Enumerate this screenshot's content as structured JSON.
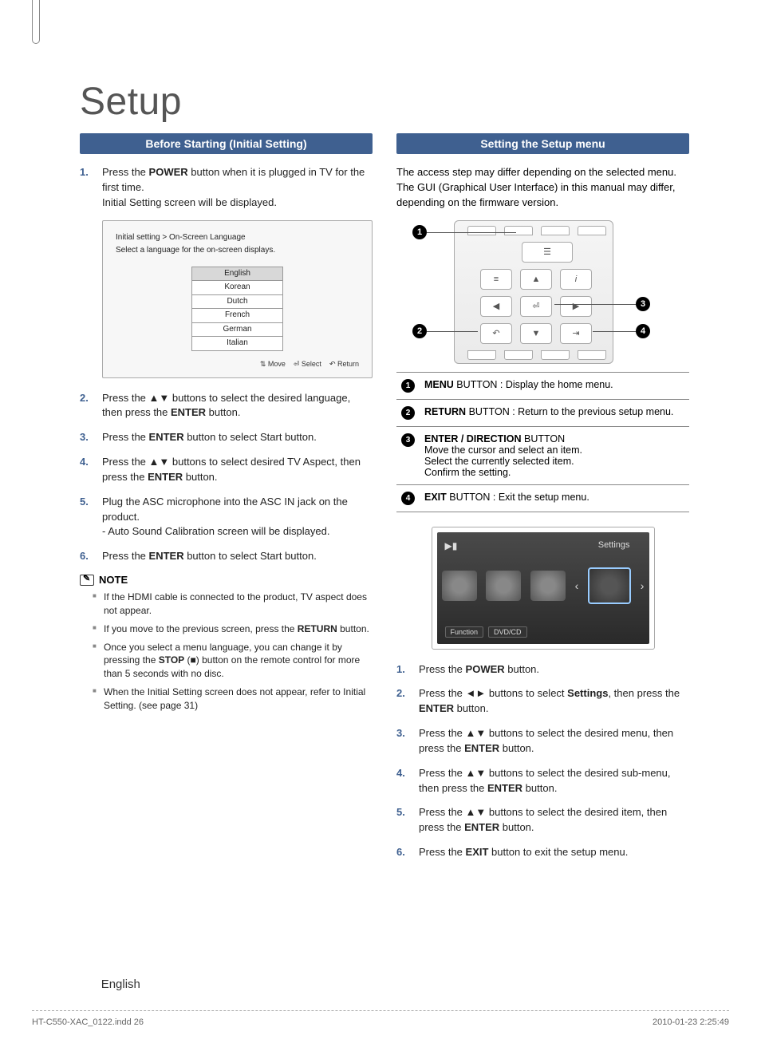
{
  "title": "Setup",
  "left": {
    "header": "Before Starting (Initial Setting)",
    "steps": [
      {
        "text": "Press the <b>POWER</b> button when it is plugged in TV for the first time.",
        "sub": "Initial Setting screen will be displayed."
      },
      {
        "text": "Press the ▲▼ buttons to select the desired language, then press the <b>ENTER</b> button."
      },
      {
        "text": "Press the <b>ENTER</b> button to select Start button."
      },
      {
        "text": "Press the ▲▼ buttons to select desired TV Aspect, then press the <b>ENTER</b> button."
      },
      {
        "text": "Plug the ASC microphone into the ASC IN jack on the product.",
        "sub": "- Auto Sound Calibration screen will be displayed."
      },
      {
        "text": "Press the <b>ENTER</b> button to select Start button."
      }
    ],
    "osd": {
      "crumb": "Initial setting > On-Screen Language",
      "prompt": "Select a language for the on-screen displays.",
      "items": [
        "English",
        "Korean",
        "Dutch",
        "French",
        "German",
        "Italian"
      ],
      "selected_index": 0,
      "foot": {
        "move": "Move",
        "select": "Select",
        "ret": "Return"
      }
    },
    "note_label": "NOTE",
    "notes": [
      "If the HDMI cable is connected to the product, TV aspect does not appear.",
      "If you move to the previous screen, press the <b>RETURN</b> button.",
      "Once you select a menu language, you can change it by pressing the <b>STOP</b> (■) button on the remote control for more than 5 seconds with no disc.",
      "When the Initial Setting screen does not appear, refer to Initial Setting. (see page 31)"
    ]
  },
  "right": {
    "header": "Setting the Setup menu",
    "intro": "The access step may differ depending on the selected menu. The GUI (Graphical User Interface) in this manual may differ, depending on the firmware version.",
    "buttons_table": [
      {
        "n": "1",
        "html": "<b>MENU</b> BUTTON : Display the home menu."
      },
      {
        "n": "2",
        "html": "<b>RETURN</b> BUTTON : Return to the previous setup menu."
      },
      {
        "n": "3",
        "html": "<b>ENTER / DIRECTION</b> BUTTON<br>Move the cursor and select an item.<br>Select the currently selected item.<br>Confirm the setting."
      },
      {
        "n": "4",
        "html": "<b>EXIT</b> BUTTON : Exit the setup menu."
      }
    ],
    "settings_panel": {
      "label": "Settings",
      "foot": [
        "Function",
        "DVD/CD"
      ]
    },
    "steps": [
      {
        "text": "Press the <b>POWER</b> button."
      },
      {
        "text": "Press the ◄► buttons to select <b>Settings</b>, then press the <b>ENTER</b> button."
      },
      {
        "text": "Press the ▲▼ buttons to select the desired menu, then press the <b>ENTER</b> button."
      },
      {
        "text": "Press the ▲▼ buttons to select the desired sub-menu, then press the <b>ENTER</b> button."
      },
      {
        "text": "Press the ▲▼ buttons to select the desired item, then press the <b>ENTER</b> button."
      },
      {
        "text": "Press the <b>EXIT</b> button to exit the setup menu."
      }
    ]
  },
  "page_lang": "English",
  "footer": {
    "file": "HT-C550-XAC_0122.indd   26",
    "date": "2010-01-23   2:25:49"
  }
}
